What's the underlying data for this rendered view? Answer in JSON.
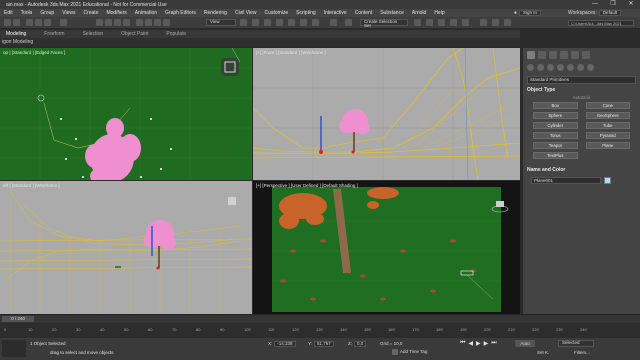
{
  "window": {
    "title": "ain.max - Autodesk 3ds Max 2021 Educational - Not for Commercial Use",
    "controls": [
      "—",
      "❐",
      "✕"
    ]
  },
  "menu": {
    "items": [
      "Edit",
      "Tools",
      "Group",
      "Views",
      "Create",
      "Modifiers",
      "Animation",
      "Graph Editors",
      "Rendering",
      "Civil View",
      "Customize",
      "Scripting",
      "Interactive",
      "Content",
      "Substance",
      "Arnold",
      "Help"
    ],
    "sign_in": "Sign In",
    "workspaces_label": "Workspaces:",
    "workspace_value": "Default"
  },
  "toolbar": {
    "view_dropdown": "View",
    "selection_set": "Create Selection Set",
    "path": "C:\\Users\\Sul...3ds Max 2021"
  },
  "ribbon": {
    "tabs": [
      "Modeling",
      "Freeform",
      "Selection",
      "Object Paint",
      "Populate"
    ],
    "active_tab": "Modeling",
    "subpanel": "igon Modeling"
  },
  "viewports": {
    "top_left_label": "op ] [Standard ] [Edged Faces ]",
    "top_right_label": "[+] [Front ] [Standard ] [Wireframe ]",
    "bottom_left_label": "eft ] [Standard ] [Wireframe ]",
    "bottom_right_label": "[+] [Perspective ] [User Defined ] [Default Shading ]"
  },
  "command_panel": {
    "category": "Standard Primitives",
    "object_type_header": "Object Type",
    "autogrid": "AutoGrid",
    "buttons": [
      "Box",
      "Cone",
      "Sphere",
      "GeoSphere",
      "Cylinder",
      "Tube",
      "Torus",
      "Pyramid",
      "Teapot",
      "Plane",
      "TextPlus"
    ],
    "name_color_header": "Name and Color",
    "name_value": "Plane001",
    "color": "#a4e0f0"
  },
  "timeline": {
    "frame": "0 / 240",
    "ticks": [
      "0",
      "10",
      "20",
      "30",
      "40",
      "50",
      "60",
      "70",
      "80",
      "90",
      "100",
      "110",
      "120",
      "130",
      "140",
      "150",
      "160",
      "170",
      "180",
      "190",
      "200",
      "210",
      "220",
      "230",
      "240"
    ]
  },
  "status": {
    "selection": "1 Object Selected",
    "prompt": "drag to select and move objects",
    "x_label": "X:",
    "x_value": "-14,338",
    "y_label": "Y:",
    "y_value": "51,767",
    "z_label": "Z:",
    "z_value": "0,0",
    "grid": "Grid = 10,0",
    "add_time_tag": "Add Time Tag",
    "auto": "Auto",
    "set_k": "Set K.",
    "selected": "Selected",
    "filters": "Filters..."
  }
}
